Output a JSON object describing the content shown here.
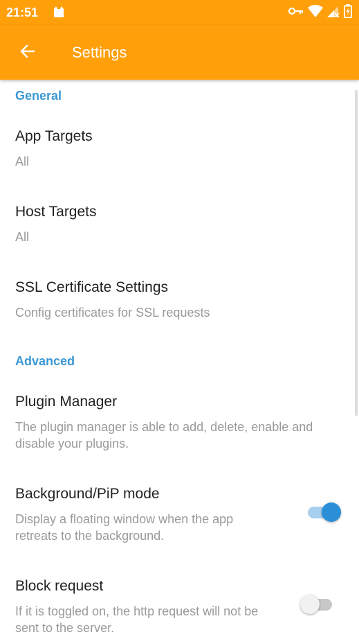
{
  "status_bar": {
    "time": "21:51",
    "icons": [
      "cat-notification-icon",
      "vpn-key-icon",
      "wifi-icon",
      "signal-icon",
      "battery-icon"
    ]
  },
  "app_bar": {
    "title": "Settings",
    "back_icon": "arrow-left-icon",
    "color": "#ff9f0a"
  },
  "sections": {
    "general": {
      "header": "General"
    },
    "advanced": {
      "header": "Advanced"
    }
  },
  "items": {
    "app_targets": {
      "title": "App Targets",
      "summary": "All"
    },
    "host_targets": {
      "title": "Host Targets",
      "summary": "All"
    },
    "ssl_settings": {
      "title": "SSL Certificate Settings",
      "summary": "Config certificates for SSL requests"
    },
    "plugin_manager": {
      "title": "Plugin Manager",
      "summary": "The plugin manager is able to add, delete, enable and disable your plugins."
    },
    "background_pip": {
      "title": "Background/PiP mode",
      "summary": "Display a floating window when the app retreats to the background.",
      "enabled": true
    },
    "block_request": {
      "title": "Block request",
      "summary": "If it is toggled on, the http request will not be sent to the server.",
      "enabled": false
    }
  },
  "colors": {
    "accent": "#3c98d3",
    "toggle_on": "#2b8fd8",
    "primary": "#ff9f0a"
  }
}
